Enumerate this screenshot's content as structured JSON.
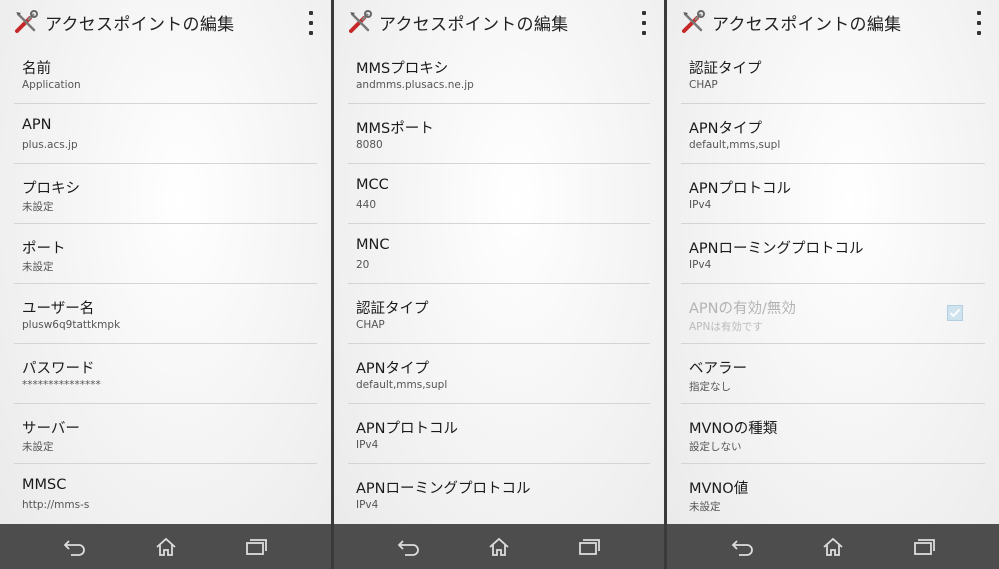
{
  "screens": [
    {
      "title": "アクセスポイントの編集",
      "items": [
        {
          "label": "名前",
          "value": "Application"
        },
        {
          "label": "APN",
          "value": "plus.acs.jp"
        },
        {
          "label": "プロキシ",
          "value": "未設定"
        },
        {
          "label": "ポート",
          "value": "未設定"
        },
        {
          "label": "ユーザー名",
          "value": "plusw6q9tattkmpk"
        },
        {
          "label": "パスワード",
          "value": "***************"
        },
        {
          "label": "サーバー",
          "value": "未設定"
        },
        {
          "label": "MMSC",
          "value": "http://mms-s"
        }
      ]
    },
    {
      "title": "アクセスポイントの編集",
      "items": [
        {
          "label": "MMSプロキシ",
          "value": "andmms.plusacs.ne.jp"
        },
        {
          "label": "MMSポート",
          "value": "8080"
        },
        {
          "label": "MCC",
          "value": "440"
        },
        {
          "label": "MNC",
          "value": "20"
        },
        {
          "label": "認証タイプ",
          "value": "CHAP"
        },
        {
          "label": "APNタイプ",
          "value": "default,mms,supl"
        },
        {
          "label": "APNプロトコル",
          "value": "IPv4"
        },
        {
          "label": "APNローミングプロトコル",
          "value": "IPv4"
        }
      ]
    },
    {
      "title": "アクセスポイントの編集",
      "items": [
        {
          "label": "認証タイプ",
          "value": "CHAP"
        },
        {
          "label": "APNタイプ",
          "value": "default,mms,supl"
        },
        {
          "label": "APNプロトコル",
          "value": "IPv4"
        },
        {
          "label": "APNローミングプロトコル",
          "value": "IPv4"
        },
        {
          "label": "APNの有効/無効",
          "value": "APNは有効です",
          "disabled": true,
          "checked": true
        },
        {
          "label": "ベアラー",
          "value": "指定なし"
        },
        {
          "label": "MVNOの種類",
          "value": "設定しない"
        },
        {
          "label": "MVNO値",
          "value": "未設定"
        }
      ]
    }
  ],
  "icons": {
    "app": "settings-tools-icon",
    "overflow": "overflow-menu-icon",
    "back": "back-icon",
    "home": "home-icon",
    "recents": "recent-apps-icon"
  },
  "colors": {
    "navbar": "#4d4d4d",
    "accent_red": "#c62828",
    "checkbox": "#cfe3ee"
  }
}
